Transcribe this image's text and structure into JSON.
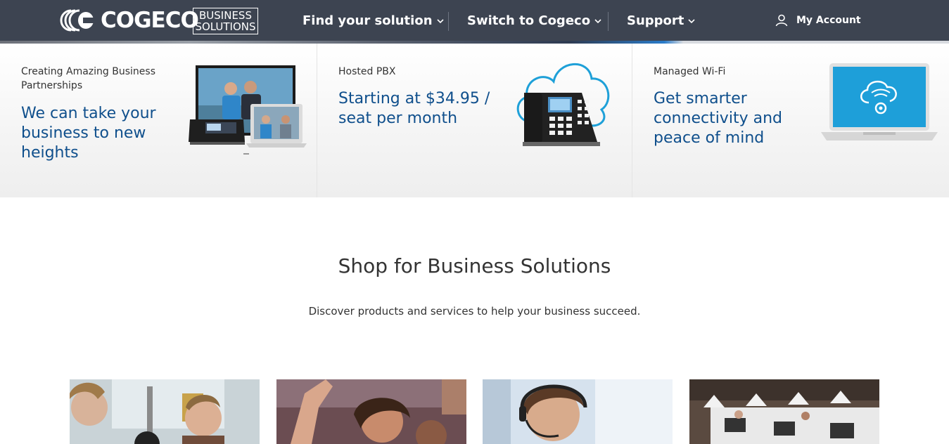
{
  "header": {
    "logo_text": "COGECO",
    "business_line1": "BUSINESS",
    "business_line2": "SOLUTIONS",
    "nav": [
      {
        "label": "Find your solution"
      },
      {
        "label": "Switch to Cogeco"
      },
      {
        "label": "Support"
      }
    ],
    "account_label": "My Account"
  },
  "promos": [
    {
      "kicker": "Creating Amazing Business Partnerships",
      "headline": "We can take your business to new heights"
    },
    {
      "kicker": "Hosted PBX",
      "headline": "Starting at $34.95 / seat per month"
    },
    {
      "kicker": "Managed Wi-Fi",
      "headline": "Get smarter connectivity and peace of mind"
    }
  ],
  "shop": {
    "title": "Shop for Business Solutions",
    "subtitle": "Discover products and services to help your business succeed."
  },
  "colors": {
    "header_bg": "#3d4451",
    "headline_blue": "#0f4f8c",
    "accent_cyan": "#1ea0d8"
  }
}
